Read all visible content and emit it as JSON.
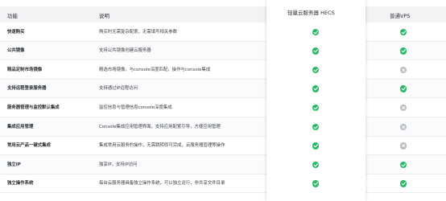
{
  "header": {
    "feature": "功能",
    "description": "说明",
    "hecs": "轻量云服务器 HECS",
    "vps": "普通VPS"
  },
  "colors": {
    "check": "#2bb868",
    "cross": "#b9bcc0",
    "header_bg": "#f2f3f5"
  },
  "rows": [
    {
      "feature": "快速购买",
      "description": "购买时无需复杂配置，无需填写相关参数",
      "hecs": "check-icon",
      "vps": "check-icon"
    },
    {
      "feature": "公共镜像",
      "description": "支持公共镜像创建云服务器",
      "hecs": "check-icon",
      "vps": "check-icon"
    },
    {
      "feature": "精品定制市场镜像",
      "description": "精选市场镜像，与console深度匹配，操作与console集成",
      "hecs": "check-icon",
      "vps": "cross-icon"
    },
    {
      "feature": "支持远程登录服务器",
      "description": "支持通过IP远程访问",
      "hecs": "check-icon",
      "vps": "check-icon"
    },
    {
      "feature": "服务器管理与监控默认集成",
      "description": "监控信息与管理信息console深度集成",
      "hecs": "check-icon",
      "vps": "cross-icon"
    },
    {
      "feature": "集成应用管理",
      "description": "Console集成应用管理界面，支持应用配置引导，方便应用管理",
      "hecs": "check-icon",
      "vps": "cross-icon"
    },
    {
      "feature": "常用云产品一键式集成",
      "description": "集成常用云服务的操作，无需跳转即可完成，云服务器管理等操作",
      "hecs": "check-icon",
      "vps": "cross-icon"
    },
    {
      "feature": "独立IP",
      "description": "独享IP，支持IP访问",
      "hecs": "check-icon",
      "vps": "check-icon"
    },
    {
      "feature": "独立操作系统",
      "description": "每台云服务器具备独立操作系统，可以独立运行，非共享文件目录",
      "hecs": "check-icon",
      "vps": "check-icon"
    }
  ]
}
